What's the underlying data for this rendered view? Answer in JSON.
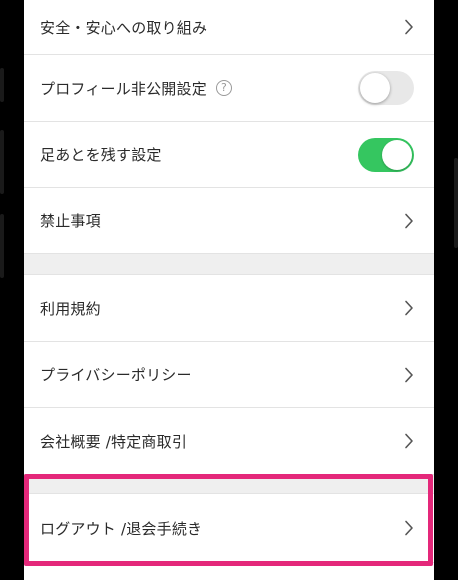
{
  "settings": {
    "safety": {
      "label": "安全・安心への取り組み"
    },
    "profile_private": {
      "label": "プロフィール非公開設定",
      "help_icon": "question-circle-icon",
      "enabled": false
    },
    "footprints": {
      "label": "足あとを残す設定",
      "enabled": true
    },
    "prohibited": {
      "label": "禁止事項"
    },
    "terms": {
      "label": "利用規約"
    },
    "privacy": {
      "label": "プライバシーポリシー"
    },
    "company": {
      "label": "会社概要 /特定商取引"
    },
    "logout": {
      "label": "ログアウト /退会手続き"
    }
  },
  "colors": {
    "toggle_on": "#35c660",
    "toggle_off": "#e8e8e8",
    "highlight": "#e4287a",
    "section_gap": "#efefef"
  }
}
